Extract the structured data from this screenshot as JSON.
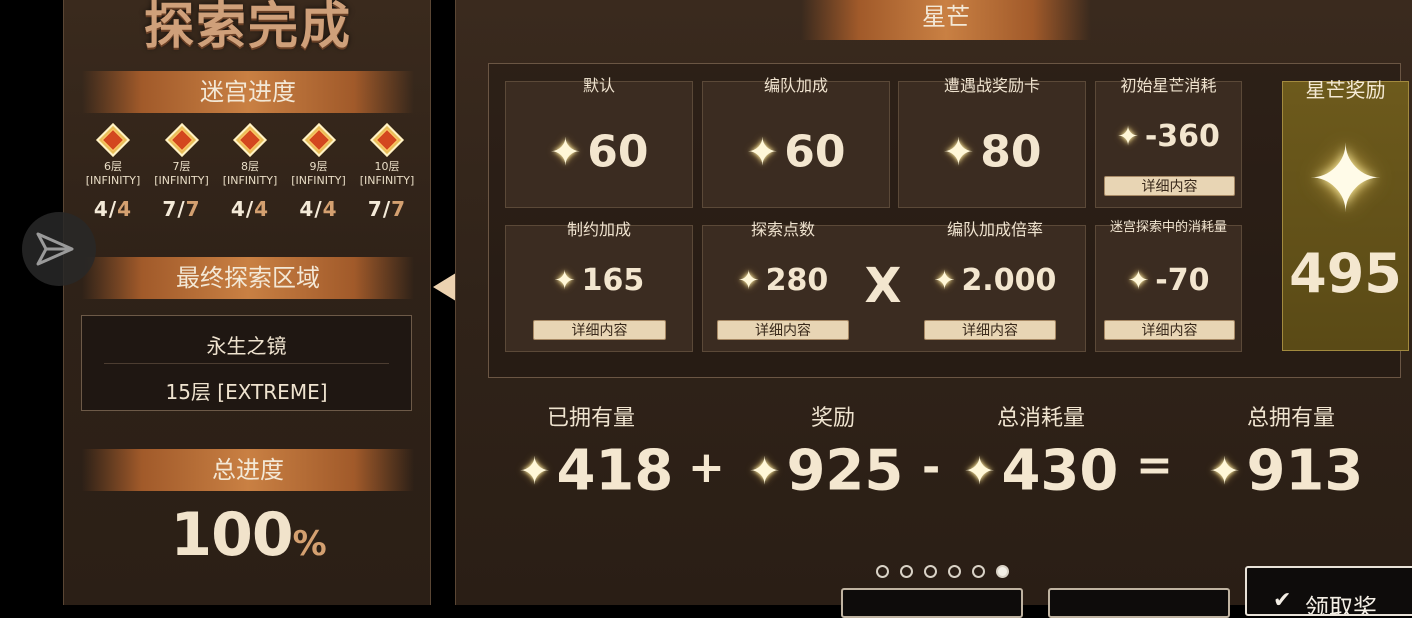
{
  "left": {
    "title": "探索完成",
    "maze_progress_label": "迷宫进度",
    "floors": [
      {
        "name": "6层",
        "tag": "[INFINITY]",
        "done": "4",
        "total": "4"
      },
      {
        "name": "7层",
        "tag": "[INFINITY]",
        "done": "7",
        "total": "7"
      },
      {
        "name": "8层",
        "tag": "[INFINITY]",
        "done": "4",
        "total": "4"
      },
      {
        "name": "9层",
        "tag": "[INFINITY]",
        "done": "4",
        "total": "4"
      },
      {
        "name": "10层",
        "tag": "[INFINITY]",
        "done": "7",
        "total": "7"
      }
    ],
    "final_area_label": "最终探索区域",
    "final_area_name": "永生之镜",
    "final_area_floor": "15层 [EXTREME]",
    "total_progress_label": "总进度",
    "total_progress_value": "100",
    "total_progress_unit": "%"
  },
  "right": {
    "header": "星芒",
    "cells": {
      "default": {
        "label": "默认",
        "value": "60"
      },
      "team_bonus": {
        "label": "编队加成",
        "value": "60"
      },
      "encounter_card": {
        "label": "遭遇战奖励卡",
        "value": "80"
      },
      "initial_cost": {
        "label": "初始星芒消耗",
        "value": "-360"
      },
      "restriction_bonus": {
        "label": "制约加成",
        "value": "165"
      },
      "explore_points": {
        "label": "探索点数",
        "value": "280"
      },
      "multiply_sign": "X",
      "team_bonus_rate": {
        "label": "编队加成倍率",
        "value": "2.000"
      },
      "maze_cost": {
        "label": "迷宫探索中的消耗量",
        "value": "-70"
      }
    },
    "detail_button": "详细内容",
    "reward": {
      "label": "星芒奖励",
      "value": "495"
    },
    "summary": {
      "owned": {
        "label": "已拥有量",
        "value": "418"
      },
      "plus": "+",
      "reward": {
        "label": "奖励",
        "value": "925"
      },
      "minus": "-",
      "consumed": {
        "label": "总消耗量",
        "value": "430"
      },
      "equals": "=",
      "total": {
        "label": "总拥有量",
        "value": "913"
      }
    },
    "pagination": {
      "pages": 6,
      "current": 6
    },
    "claim_button_partial": "领取奖"
  },
  "icons": {
    "star": "star-icon",
    "send": "send-icon",
    "prev": "prev-arrow-icon"
  }
}
